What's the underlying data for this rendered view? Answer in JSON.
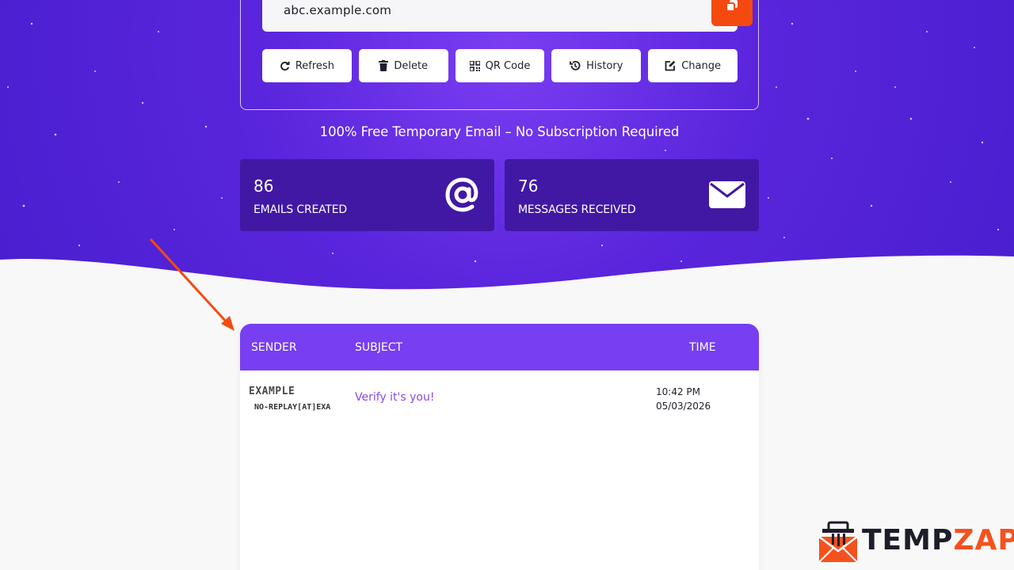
{
  "email": {
    "address": "abc.example.com",
    "copy_icon": "copy-icon"
  },
  "actions": [
    {
      "label": "Refresh",
      "icon": "refresh-icon"
    },
    {
      "label": "Delete",
      "icon": "trash-icon"
    },
    {
      "label": "QR Code",
      "icon": "qr-code-icon"
    },
    {
      "label": "History",
      "icon": "history-icon"
    },
    {
      "label": "Change",
      "icon": "edit-icon"
    }
  ],
  "tagline": "100% Free Temporary Email – No Subscription Required",
  "stats": [
    {
      "value": "86",
      "label": "EMAILS CREATED",
      "icon": "at-sign-icon"
    },
    {
      "value": "76",
      "label": "MESSAGES RECEIVED",
      "icon": "envelope-icon"
    }
  ],
  "inbox": {
    "columns": {
      "sender": "SENDER",
      "subject": "SUBJECT",
      "time": "TIME"
    },
    "messages": [
      {
        "sender_name": "EXAMPLE",
        "sender_email": "NO-REPLAY[AT]EXA",
        "subject": "Verify it's you!",
        "time": "10:42 PM",
        "date": "05/03/2026"
      }
    ]
  },
  "brand": {
    "part1": "TEMP",
    "part2": "ZAP"
  },
  "colors": {
    "hero_purple": "#5b22d8",
    "accent_orange": "#f44a10",
    "stat_bg": "#4118a4",
    "table_head": "#773ff1",
    "subject_text": "#8a4ae8"
  }
}
